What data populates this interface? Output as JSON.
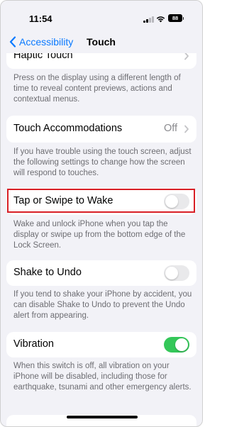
{
  "status_bar": {
    "time": "11:54",
    "battery_level": "88"
  },
  "nav": {
    "back_label": "Accessibility",
    "title": "Touch"
  },
  "sections": {
    "haptic_touch": {
      "label": "Haptic Touch",
      "footer": "Press on the display using a different length of time to reveal content previews, actions and contextual menus."
    },
    "touch_accommodations": {
      "label": "Touch Accommodations",
      "value": "Off",
      "footer": "If you have trouble using the touch screen, adjust the following settings to change how the screen will respond to touches."
    },
    "tap_or_swipe_to_wake": {
      "label": "Tap or Swipe to Wake",
      "enabled": false,
      "footer": "Wake and unlock iPhone when you tap the display or swipe up from the bottom edge of the Lock Screen."
    },
    "shake_to_undo": {
      "label": "Shake to Undo",
      "enabled": false,
      "footer": "If you tend to shake your iPhone by accident, you can disable Shake to Undo to prevent the Undo alert from appearing."
    },
    "vibration": {
      "label": "Vibration",
      "enabled": true,
      "footer": "When this switch is off, all vibration on your iPhone will be disabled, including those for earthquake, tsunami and other emergency alerts."
    }
  },
  "colors": {
    "accent": "#0a7aff",
    "toggle_on": "#34c759",
    "toggle_off": "#e9e9eb",
    "highlight_border": "#d81f26",
    "background": "#f2f2f7"
  },
  "icons": {
    "back": "chevron-left-icon",
    "disclosure": "chevron-right-icon",
    "wifi": "wifi-icon",
    "signal": "cellular-signal-icon",
    "battery": "battery-icon"
  }
}
